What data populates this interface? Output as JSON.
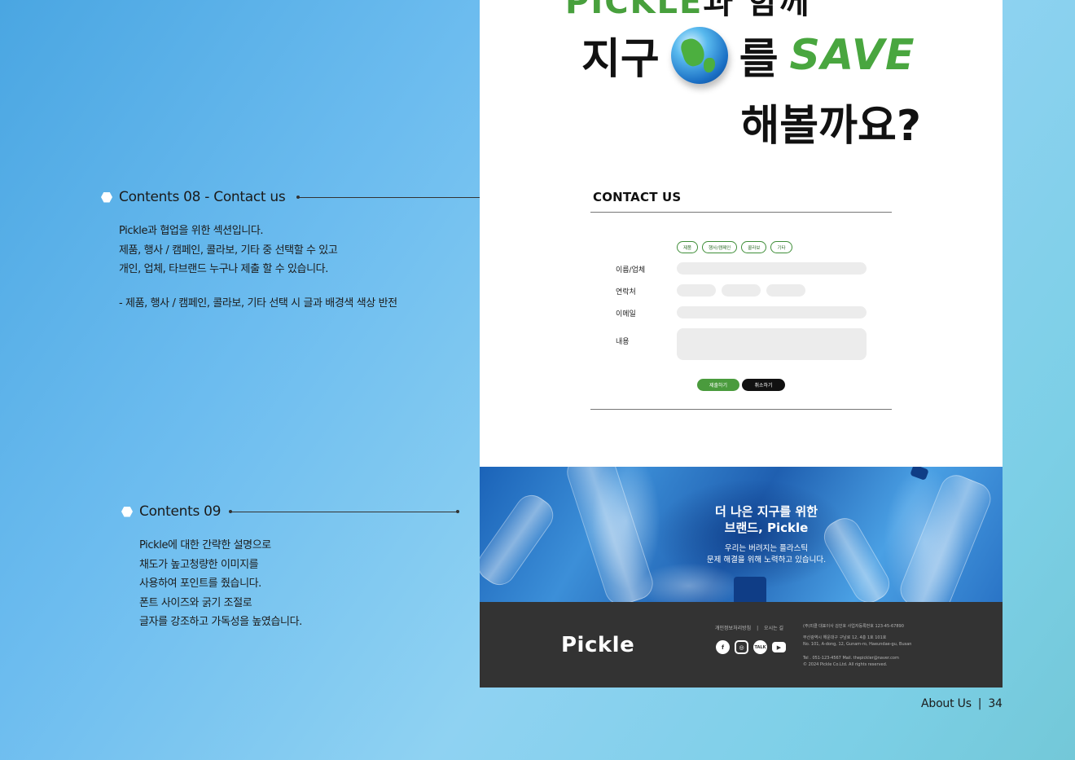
{
  "annotations": {
    "contents08": {
      "title": "Contents 08 - Contact us",
      "lines": [
        "Pickle과 협업을 위한 섹션입니다.",
        "제품, 행사 / 캠페인, 콜라보, 기타  중 선택할 수 있고",
        "개인, 업체, 타브랜드 누구나 제출 할 수 있습니다."
      ],
      "note": "- 제품, 행사 / 캠페인, 콜라보, 기타 선택 시 글과 배경색 색상 반전"
    },
    "contents09": {
      "title": "Contents 09",
      "lines": [
        "Pickle에 대한 간략한 설명으로",
        "채도가 높고청량한 이미지를",
        "사용하여 포인트를 줬습니다.",
        "폰트 사이즈와 굵기 조절로",
        "글자를 강조하고 가독성을 높였습니다."
      ]
    }
  },
  "hero": {
    "cut_part1": "PICKLE",
    "cut_part2": "과 함께",
    "line1_text": "지구",
    "line1_particle": "를",
    "line1_save": "SAVE",
    "line2": "해볼까요?"
  },
  "contact": {
    "title": "CONTACT US",
    "chips": [
      "제품",
      "행사/캠페인",
      "콜라보",
      "기타"
    ],
    "labels": {
      "name": "이름/업체",
      "phone": "연락처",
      "email": "이메일",
      "message": "내용"
    },
    "submit_label": "제출하기",
    "cancel_label": "취소하기"
  },
  "banner": {
    "title_line1": "더 나은 지구를 위한",
    "title_line2": "브랜드, Pickle",
    "sub_line1": "우리는 버려지는 플라스틱",
    "sub_line2": "문제 해결을 위해 노력하고 있습니다."
  },
  "footer": {
    "logo": "Pickle",
    "link_privacy": "개인정보처리방침",
    "link_divider": "|",
    "link_directions": "오시는 길",
    "social": [
      "facebook-icon",
      "instagram-icon",
      "kakaotalk-icon",
      "youtube-icon"
    ],
    "talk_label": "TALK",
    "company_line": "(주)피클    대표이사 김민호    사업자등록번호 123-45-67890",
    "address_ko": "부산광역시 해운대구 구남로 12, 4층 1호 101호",
    "address_en": "No. 101, A-dong, 12, Gunam-ro, Haeundae-gu, Busan",
    "contact_line": "Tel . 051-123-4567      Mail. thepickler@naver.com",
    "copyright": "© 2024 Pickle Co.Ltd. All rights reserved."
  },
  "page_footer": {
    "section": "About Us",
    "divider": "|",
    "page": "34"
  },
  "colors": {
    "brand_green": "#49a63f",
    "footer_bg": "#333333",
    "field_bg": "#ececec"
  }
}
